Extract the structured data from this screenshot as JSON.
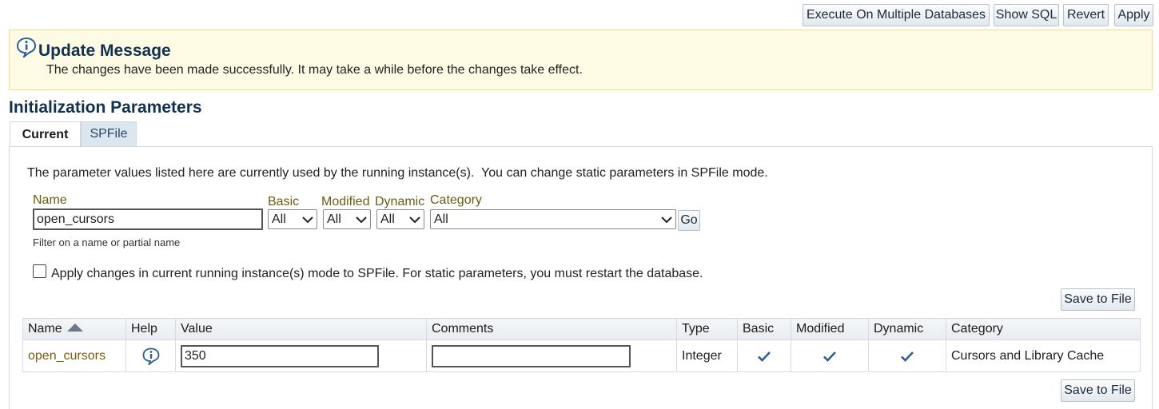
{
  "toolbar": {
    "execute_label": "Execute On Multiple Databases",
    "show_sql_label": "Show SQL",
    "revert_label": "Revert",
    "apply_label": "Apply"
  },
  "message": {
    "title": "Update Message",
    "text": "The changes have been made successfully. It may take a while before the changes take effect."
  },
  "section_title": "Initialization Parameters",
  "tabs": [
    {
      "label": "Current",
      "active": true
    },
    {
      "label": "SPFile",
      "active": false
    }
  ],
  "description": "The parameter values listed here are currently used by the running instance(s).  You can change static parameters in SPFile mode.",
  "filters": {
    "name_label": "Name",
    "name_value": "open_cursors",
    "basic_label": "Basic",
    "basic_value": "All",
    "modified_label": "Modified",
    "modified_value": "All",
    "dynamic_label": "Dynamic",
    "dynamic_value": "All",
    "category_label": "Category",
    "category_value": "All",
    "go_label": "Go",
    "hint": "Filter on a name or partial name"
  },
  "apply_checkbox": {
    "checked": false,
    "label": "Apply changes in current running instance(s) mode to SPFile. For static parameters, you must restart the database."
  },
  "save_label": "Save to File",
  "table": {
    "columns": [
      "Name",
      "Help",
      "Value",
      "Comments",
      "Type",
      "Basic",
      "Modified",
      "Dynamic",
      "Category"
    ],
    "rows": [
      {
        "name": "open_cursors",
        "value": "350",
        "comments": "",
        "type": "Integer",
        "basic": true,
        "modified": true,
        "dynamic": true,
        "category": "Cursors and Library Cache"
      }
    ]
  },
  "colors": {
    "accent_title": "#10314f",
    "label_brown": "#6b5a12",
    "message_bg": "#fefbe5",
    "check_blue": "#2f5f8f"
  },
  "icons": [
    "info-icon",
    "sort-ascending-icon",
    "help-info-icon",
    "checkmark-icon",
    "chevron-down-icon"
  ]
}
